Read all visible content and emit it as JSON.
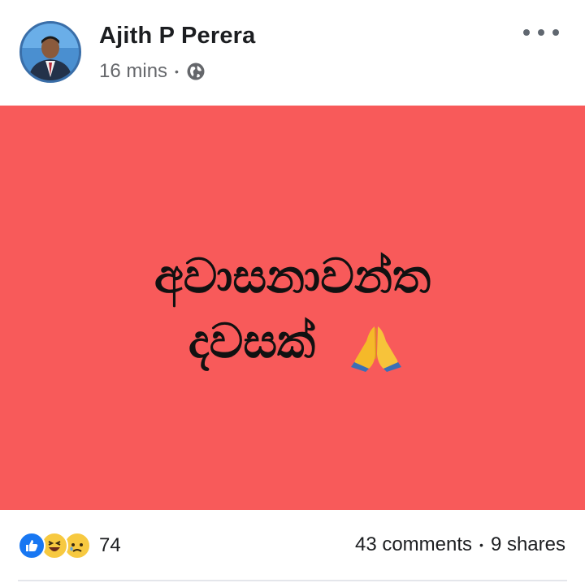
{
  "post": {
    "author": "Ajith P Perera",
    "time": "16 mins",
    "separator": "•",
    "privacy_icon": "globe-icon",
    "more_icon": "more-horizontal-icon",
    "text_line1": "අවාසනාවන්ත",
    "text_line2": "දවසක්",
    "emoji": "folded-hands-icon",
    "background_color": "#f85a5a"
  },
  "footer": {
    "reaction_icons": [
      "like-icon",
      "haha-icon",
      "sad-icon"
    ],
    "reaction_count": "74",
    "comments": "43 comments",
    "separator": "•",
    "shares": "9 shares"
  }
}
